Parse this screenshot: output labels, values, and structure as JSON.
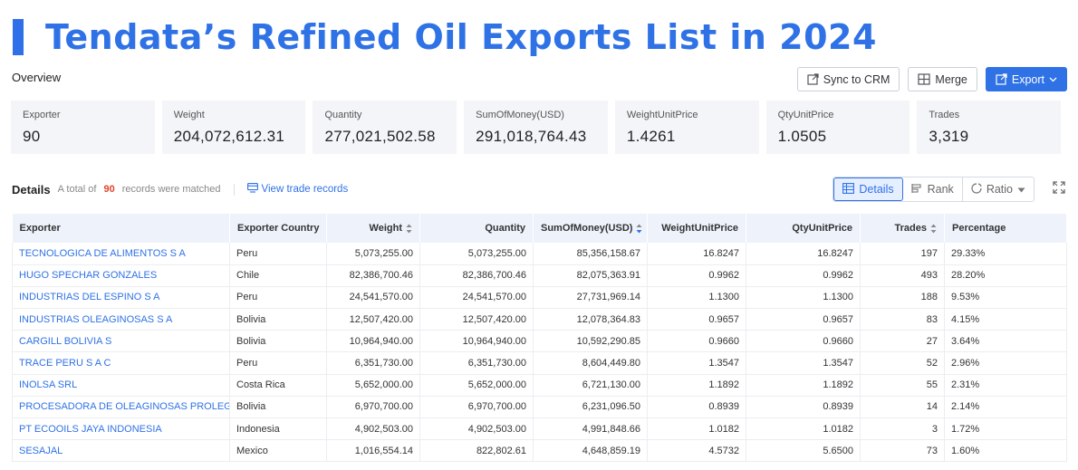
{
  "page_title": "Tendata’s Refined Oil Exports List in 2024",
  "overview_label": "Overview",
  "actions": {
    "sync_label": "Sync to CRM",
    "merge_label": "Merge",
    "export_label": "Export"
  },
  "stats": [
    {
      "label": "Exporter",
      "value": "90"
    },
    {
      "label": "Weight",
      "value": "204,072,612.31"
    },
    {
      "label": "Quantity",
      "value": "277,021,502.58"
    },
    {
      "label": "SumOfMoney(USD)",
      "value": "291,018,764.43"
    },
    {
      "label": "WeightUnitPrice",
      "value": "1.4261"
    },
    {
      "label": "QtyUnitPrice",
      "value": "1.0505"
    },
    {
      "label": "Trades",
      "value": "3,319"
    }
  ],
  "details": {
    "title": "Details",
    "prefix": "A total of",
    "count": "90",
    "suffix": "records were matched",
    "view_link": "View trade records",
    "tabs": {
      "details": "Details",
      "rank": "Rank",
      "ratio": "Ratio"
    }
  },
  "table": {
    "headers": [
      "Exporter",
      "Exporter Country",
      "Weight",
      "Quantity",
      "SumOfMoney(USD)",
      "WeightUnitPrice",
      "QtyUnitPrice",
      "Trades",
      "Percentage"
    ],
    "rows": [
      [
        "TECNOLOGICA DE ALIMENTOS S A",
        "Peru",
        "5,073,255.00",
        "5,073,255.00",
        "85,356,158.67",
        "16.8247",
        "16.8247",
        "197",
        "29.33%"
      ],
      [
        "HUGO SPECHAR GONZALES",
        "Chile",
        "82,386,700.46",
        "82,386,700.46",
        "82,075,363.91",
        "0.9962",
        "0.9962",
        "493",
        "28.20%"
      ],
      [
        "INDUSTRIAS DEL ESPINO S A",
        "Peru",
        "24,541,570.00",
        "24,541,570.00",
        "27,731,969.14",
        "1.1300",
        "1.1300",
        "188",
        "9.53%"
      ],
      [
        "INDUSTRIAS OLEAGINOSAS S A",
        "Bolivia",
        "12,507,420.00",
        "12,507,420.00",
        "12,078,364.83",
        "0.9657",
        "0.9657",
        "83",
        "4.15%"
      ],
      [
        "CARGILL BOLIVIA S",
        "Bolivia",
        "10,964,940.00",
        "10,964,940.00",
        "10,592,290.85",
        "0.9660",
        "0.9660",
        "27",
        "3.64%"
      ],
      [
        "TRACE PERU S A C",
        "Peru",
        "6,351,730.00",
        "6,351,730.00",
        "8,604,449.80",
        "1.3547",
        "1.3547",
        "52",
        "2.96%"
      ],
      [
        "INOLSA SRL",
        "Costa Rica",
        "5,652,000.00",
        "5,652,000.00",
        "6,721,130.00",
        "1.1892",
        "1.1892",
        "55",
        "2.31%"
      ],
      [
        "PROCESADORA DE OLEAGINOSAS PROLEGA S",
        "Bolivia",
        "6,970,700.00",
        "6,970,700.00",
        "6,231,096.50",
        "0.8939",
        "0.8939",
        "14",
        "2.14%"
      ],
      [
        "PT ECOOILS JAYA INDONESIA",
        "Indonesia",
        "4,902,503.00",
        "4,902,503.00",
        "4,991,848.66",
        "1.0182",
        "1.0182",
        "3",
        "1.72%"
      ],
      [
        "SESAJAL",
        "Mexico",
        "1,016,554.14",
        "822,802.61",
        "4,648,859.19",
        "4.5732",
        "5.6500",
        "73",
        "1.60%"
      ]
    ]
  },
  "colors": {
    "accent": "#2f72e6",
    "count_red": "#e0452d",
    "stat_bg": "#f4f5f8",
    "header_bg": "#eef2fb"
  }
}
